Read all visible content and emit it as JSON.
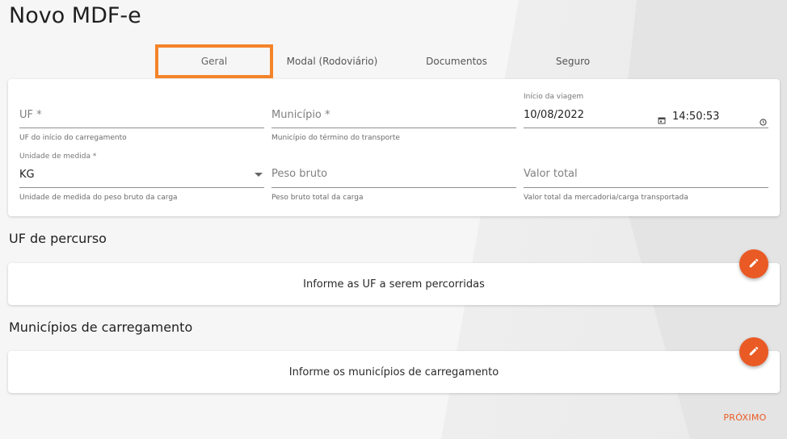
{
  "page": {
    "title": "Novo MDF-e"
  },
  "tabs": [
    {
      "label": "Geral",
      "active": true
    },
    {
      "label": "Modal (Rodoviário)",
      "active": false
    },
    {
      "label": "Documentos",
      "active": false
    },
    {
      "label": "Seguro",
      "active": false
    }
  ],
  "form": {
    "uf": {
      "placeholder": "UF *",
      "helper": "UF do início do carregamento"
    },
    "municipio": {
      "placeholder": "Município *",
      "helper": "Município do término do transporte"
    },
    "inicio_viagem": {
      "label": "Início da viagem",
      "date": "10/08/2022",
      "time": "14:50:53"
    },
    "unidade": {
      "label": "Unidade de medida *",
      "value": "KG",
      "helper": "Unidade de medida do peso bruto da carga"
    },
    "peso_bruto": {
      "placeholder": "Peso bruto",
      "helper": "Peso bruto total da carga"
    },
    "valor_total": {
      "placeholder": "Valor total",
      "helper": "Valor total da mercadoria/carga transportada"
    }
  },
  "uf_percurso": {
    "title": "UF de percurso",
    "empty_text": "Informe as UF a serem percorridas",
    "edit_icon": "pencil-icon"
  },
  "municipios": {
    "title": "Municípios de carregamento",
    "empty_text": "Informe os municípios de carregamento",
    "edit_icon": "pencil-icon"
  },
  "footer": {
    "next_label": "PRÓXIMO"
  },
  "colors": {
    "accent": "#ea5a24",
    "tab_highlight": "#f4842a"
  }
}
